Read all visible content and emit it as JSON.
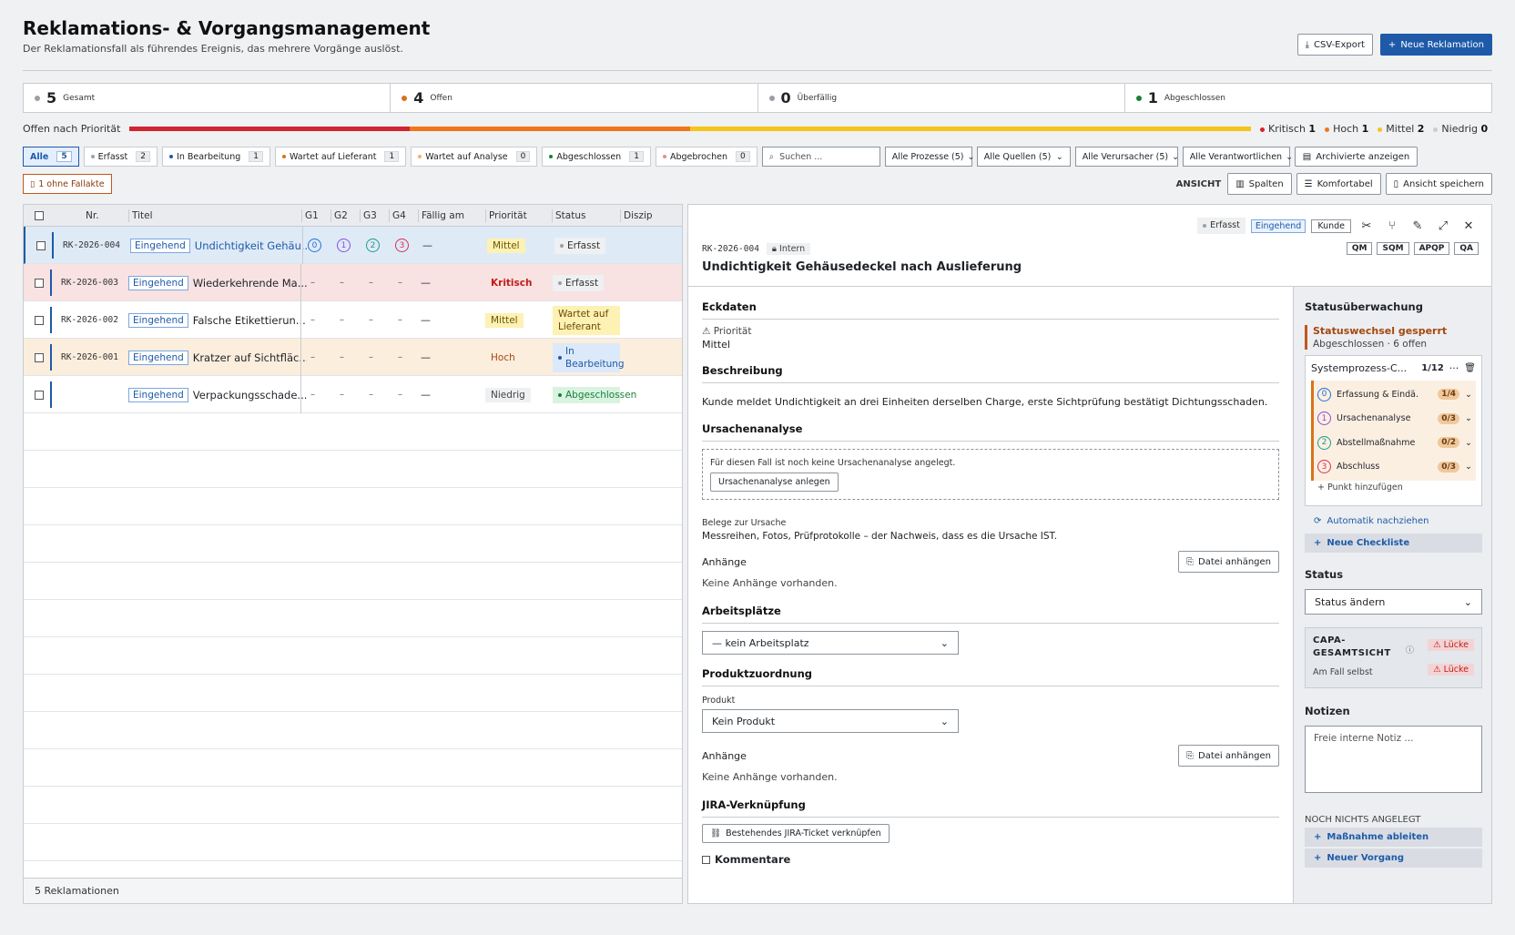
{
  "header": {
    "title": "Reklamations- & Vorgangsmanagement",
    "subtitle": "Der Reklamationsfall als führendes Ereignis, das mehrere Vorgänge auslöst.",
    "csv": "CSV-Export",
    "new": "Neue Reklamation"
  },
  "stats": [
    {
      "num": "5",
      "label": "Gesamt",
      "color": "#9aa0a6"
    },
    {
      "num": "4",
      "label": "Offen",
      "color": "#d9731a"
    },
    {
      "num": "0",
      "label": "Überfällig",
      "color": "#9aa0a6"
    },
    {
      "num": "1",
      "label": "Abgeschlossen",
      "color": "#1a7f37"
    }
  ],
  "priority": {
    "label": "Offen nach Priorität",
    "segments": [
      {
        "value": 1,
        "color": "#d1242f"
      },
      {
        "value": 1,
        "color": "#f0761c"
      },
      {
        "value": 2,
        "color": "#f5c518"
      }
    ],
    "legend": [
      {
        "label": "Kritisch",
        "count": "1",
        "color": "#d1242f"
      },
      {
        "label": "Hoch",
        "count": "1",
        "color": "#f0761c"
      },
      {
        "label": "Mittel",
        "count": "2",
        "color": "#f5c518"
      },
      {
        "label": "Niedrig",
        "count": "0",
        "color": "#c9ccd1"
      }
    ]
  },
  "filters": {
    "chips": [
      {
        "label": "Alle",
        "count": "5",
        "color": ""
      },
      {
        "label": "Erfasst",
        "count": "2",
        "color": "#9aa0a6"
      },
      {
        "label": "In Bearbeitung",
        "count": "1",
        "color": "#1e5aa8"
      },
      {
        "label": "Wartet auf Lieferant",
        "count": "1",
        "color": "#d9731a"
      },
      {
        "label": "Wartet auf Analyse",
        "count": "0",
        "color": "#f5b26b"
      },
      {
        "label": "Abgeschlossen",
        "count": "1",
        "color": "#1a7f37"
      },
      {
        "label": "Abgebrochen",
        "count": "0",
        "color": "#e58c8c"
      }
    ],
    "search": "Suchen ...",
    "dropdowns": [
      "Alle Prozesse (5)",
      "Alle Quellen (5)",
      "Alle Verursacher (5)",
      "Alle Verantwortlichen"
    ],
    "archived": "Archivierte anzeigen",
    "nocase": "1 ohne Fallakte",
    "ansicht": "ANSICHT",
    "columns": "Spalten",
    "comfort": "Komfortabel",
    "saveview": "Ansicht speichern"
  },
  "table": {
    "headers": [
      "Nr.",
      "Titel",
      "G1",
      "G2",
      "G3",
      "G4",
      "Fällig am",
      "Priorität",
      "Status",
      "Diszip"
    ],
    "rows": [
      {
        "nr": "RK-2026-004",
        "tag": "Eingehend",
        "title": "Undichtigkeit Gehäu...",
        "g": [
          "0",
          "1",
          "2",
          "3"
        ],
        "due": "—",
        "prio": "Mittel",
        "status": "Erfasst",
        "bg": "#dfeaf7",
        "pbg": "#fdf1b4",
        "pcol": "#6b5a00",
        "sbg": "#eef0f2",
        "scol": "#333",
        "sdot": "#9aa0a6"
      },
      {
        "nr": "RK-2026-003",
        "tag": "Eingehend",
        "title": "Wiederkehrende Ma...",
        "g": [
          "–",
          "–",
          "–",
          "–"
        ],
        "due": "—",
        "prio": "Kritisch",
        "status": "Erfasst",
        "bg": "#f8e2e2",
        "pbg": "transparent",
        "pcol": "#c21b1b",
        "sbg": "#eef0f2",
        "scol": "#333",
        "sdot": "#9aa0a6"
      },
      {
        "nr": "RK-2026-002",
        "tag": "Eingehend",
        "title": "Falsche Etikettierun...",
        "g": [
          "–",
          "–",
          "–",
          "–"
        ],
        "due": "—",
        "prio": "Mittel",
        "status": "Wartet auf Lieferant",
        "bg": "#ffffff",
        "pbg": "#fdf1b4",
        "pcol": "#6b5a00",
        "sbg": "#fdf1b4",
        "scol": "#6b4a00",
        "sdot": ""
      },
      {
        "nr": "RK-2026-001",
        "tag": "Eingehend",
        "title": "Kratzer auf Sichtfläc...",
        "g": [
          "–",
          "–",
          "–",
          "–"
        ],
        "due": "—",
        "prio": "Hoch",
        "status": "In Bearbeitung",
        "bg": "#fbeedd",
        "pbg": "transparent",
        "pcol": "#a5470f",
        "sbg": "#dce9fa",
        "scol": "#1e5aa8",
        "sdot": "#1e5aa8"
      },
      {
        "nr": "",
        "tag": "Eingehend",
        "title": "Verpackungsschade...",
        "g": [
          "–",
          "–",
          "–",
          "–"
        ],
        "due": "—",
        "prio": "Niedrig",
        "status": "Abgeschlossen",
        "bg": "#ffffff",
        "pbg": "#eef0f2",
        "pcol": "#444",
        "sbg": "#d9f3e1",
        "scol": "#1a7f37",
        "sdot": "#1a7f37"
      }
    ],
    "footer": "5 Reklamationen"
  },
  "detail": {
    "badge_status": "Erfasst",
    "badge_dir": "Eingehend",
    "badge_src": "Kunde",
    "id": "RK-2026-004",
    "intern": "Intern",
    "title": "Undichtigkeit Gehäusedeckel nach Auslieferung",
    "roles": [
      "QM",
      "SQM",
      "APQP",
      "QA"
    ],
    "eckdaten": "Eckdaten",
    "prio_label": "Priorität",
    "prio_value": "Mittel",
    "beschreibung": "Beschreibung",
    "beschreibung_text": "Kunde meldet Undichtigkeit an drei Einheiten derselben Charge, erste Sichtprüfung bestätigt Dichtungsschaden.",
    "ursache": "Ursachenanalyse",
    "ursache_empty": "Für diesen Fall ist noch keine Ursachenanalyse angelegt.",
    "ursache_btn": "Ursachenanalyse anlegen",
    "belege": "Belege zur Ursache",
    "belege_text": "Messreihen, Fotos, Prüfprotokolle – der Nachweis, dass es die Ursache IST.",
    "anhaenge": "Anhänge",
    "attach": "Datei anhängen",
    "no_attach": "Keine Anhänge vorhanden.",
    "arbeitsplaetze": "Arbeitsplätze",
    "arbeitsplatz_value": "— kein Arbeitsplatz",
    "produkt_sec": "Produktzuordnung",
    "produkt_label": "Produkt",
    "produkt_value": "Kein Produkt",
    "anhaenge2": "Anhänge",
    "attach2": "Datei anhängen",
    "no_attach2": "Keine Anhänge vorhanden.",
    "jira": "JIRA-Verknüpfung",
    "jira_btn": "Bestehendes JIRA-Ticket verknüpfen",
    "kommentare": "Kommentare"
  },
  "side": {
    "title": "Statusüberwachung",
    "locked": "Statuswechsel gesperrt",
    "locked_sub": "Abgeschlossen · 6 offen",
    "checklist": "Systemprozess-C...",
    "checklist_count": "1/12",
    "items": [
      {
        "n": "0",
        "label": "Erfassung & Eindä...",
        "c": "1/4",
        "color": "#1e73d8"
      },
      {
        "n": "1",
        "label": "Ursachenanalyse",
        "c": "0/3",
        "color": "#8a4fd8"
      },
      {
        "n": "2",
        "label": "Abstellmaßnahme",
        "c": "0/2",
        "color": "#1a9e8a"
      },
      {
        "n": "3",
        "label": "Abschluss",
        "c": "0/3",
        "color": "#d8304f"
      }
    ],
    "add_point": "+ Punkt hinzufügen",
    "auto": "Automatik nachziehen",
    "new_checklist": "Neue Checkliste",
    "status": "Status",
    "status_select": "Status ändern",
    "capa": "CAPA-GESAMTSICHT",
    "capa_gap": "Lücke",
    "capa_case": "Am Fall selbst",
    "capa_gap2": "Lücke",
    "notes": "Notizen",
    "notes_placeholder": "Freie interne Notiz ...",
    "none": "NOCH NICHTS ANGELEGT",
    "derive": "Maßnahme ableiten",
    "new_proc": "Neuer Vorgang"
  }
}
